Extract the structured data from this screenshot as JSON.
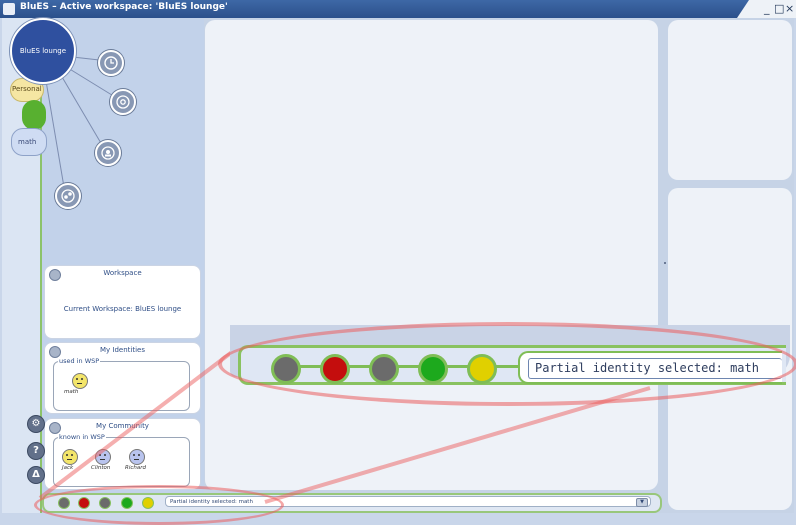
{
  "window": {
    "title": "BluES – Active workspace: 'BluES lounge'",
    "minimize": "_",
    "maximize": "□",
    "close": "×"
  },
  "workspace_circle": {
    "label": "BluES lounge"
  },
  "side_pills": [
    {
      "label": "Personal",
      "color": "#f5e6a3"
    },
    {
      "label": "",
      "color": "#58b030"
    },
    {
      "label": "math",
      "color": "#cfdcf3"
    }
  ],
  "side_buttons": [
    {
      "icon": "settings-icon",
      "glyph": "⚙"
    },
    {
      "icon": "help-icon",
      "glyph": "?"
    },
    {
      "icon": "exit-icon",
      "glyph": "Δ"
    }
  ],
  "workspace_box": {
    "title": "Workspace",
    "text": "Current Workspace: BluES lounge"
  },
  "identities_box": {
    "title": "My Identities",
    "group": "used in WSP",
    "members": [
      {
        "name": "math"
      }
    ]
  },
  "community_box": {
    "title": "My Community",
    "group": "known in WSP",
    "members": [
      {
        "name": "Jack",
        "color": "#f3e56a"
      },
      {
        "name": "Clinton",
        "color": "#b9c4ee"
      },
      {
        "name": "Richard",
        "color": "#b9c4ee"
      }
    ]
  },
  "status_lights": [
    {
      "name": "gray",
      "color": "#6b6b6b"
    },
    {
      "name": "red",
      "color": "#c40d0d"
    },
    {
      "name": "gray",
      "color": "#6b6b6b"
    },
    {
      "name": "green",
      "color": "#1da91d"
    },
    {
      "name": "yellow",
      "color": "#e0d000"
    }
  ],
  "status_text": "Partial identity selected: math",
  "zoom_status_text": "Partial identity selected: math"
}
